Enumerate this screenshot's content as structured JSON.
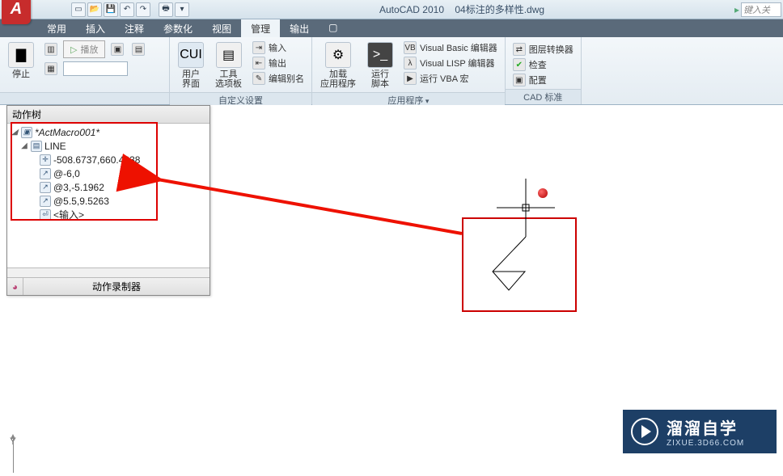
{
  "title": {
    "app": "AutoCAD 2010",
    "file": "04标注的多样性.dwg"
  },
  "search_placeholder": "键入关",
  "tabs": {
    "t0": "常用",
    "t1": "插入",
    "t2": "注释",
    "t3": "参数化",
    "t4": "视图",
    "t5": "管理",
    "t6": "输出"
  },
  "ribbon": {
    "p1": {
      "stop": "停止",
      "play": "播放"
    },
    "p2": {
      "cui": "用户\n界面",
      "tools": "工具\n选项板",
      "import": "输入",
      "export": "输出",
      "alias": "编辑别名",
      "label": "自定义设置"
    },
    "p3": {
      "load": "加载\n应用程序",
      "script": "运行\n脚本",
      "vbe": "Visual Basic 编辑器",
      "vle": "Visual LISP 编辑器",
      "vba": "运行 VBA 宏",
      "label": "应用程序"
    },
    "p4": {
      "conv": "图层转换器",
      "check": "检查",
      "config": "配置",
      "label": "CAD 标准"
    }
  },
  "tree": {
    "title": "动作树",
    "root": "*ActMacro001*",
    "cmd": "LINE",
    "p1": "-508.6737,660.4638",
    "p2": "@-6,0",
    "p3": "@3,-5.1962",
    "p4": "@5.5,9.5263",
    "enter": "<输入>",
    "footer": "动作录制器"
  },
  "axis": {
    "y": "Y"
  },
  "watermark": {
    "big": "溜溜自学",
    "small": "ZIXUE.3D66.COM"
  }
}
